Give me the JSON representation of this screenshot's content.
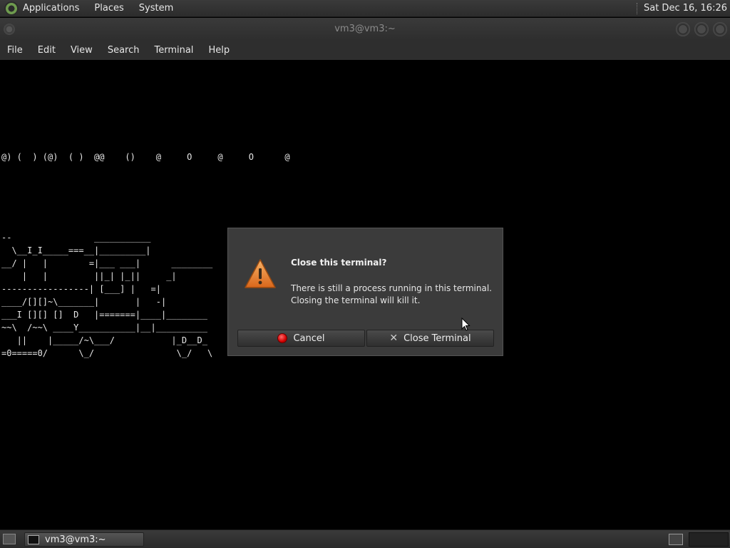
{
  "top_panel": {
    "menus": [
      "Applications",
      "Places",
      "System"
    ],
    "clock": "Sat Dec 16, 16:26"
  },
  "window": {
    "title": "vm3@vm3:~",
    "menubar": [
      "File",
      "Edit",
      "View",
      "Search",
      "Terminal",
      "Help"
    ]
  },
  "terminal": {
    "smoke_line": "@) (  ) (@)  ( )  @@    ()    @     O     @     O      @",
    "train_lines": [
      "--                ___________",
      "  \\__I_I_____===__|_________|",
      "__/ |   |        =|___ ___|      ________",
      "    |   |         ||_| |_||     _|",
      "-----------------| [___] |   =|",
      "____/[][]~\\_______|       |   -|",
      "___I [][] []  D   |=======|____|________",
      "~~\\  /~~\\ ____Y___________|__|__________",
      "   ||    |_____/~\\___/           |_D__D_",
      "=0=====0/      \\_/                \\_/   \\"
    ]
  },
  "dialog": {
    "heading": "Close this terminal?",
    "body_line1": "There is still a process running in this terminal.",
    "body_line2": "Closing the terminal will kill it.",
    "cancel_label": "Cancel",
    "close_label": "Close Terminal"
  },
  "bottom_panel": {
    "task_label": "vm3@vm3:~"
  }
}
